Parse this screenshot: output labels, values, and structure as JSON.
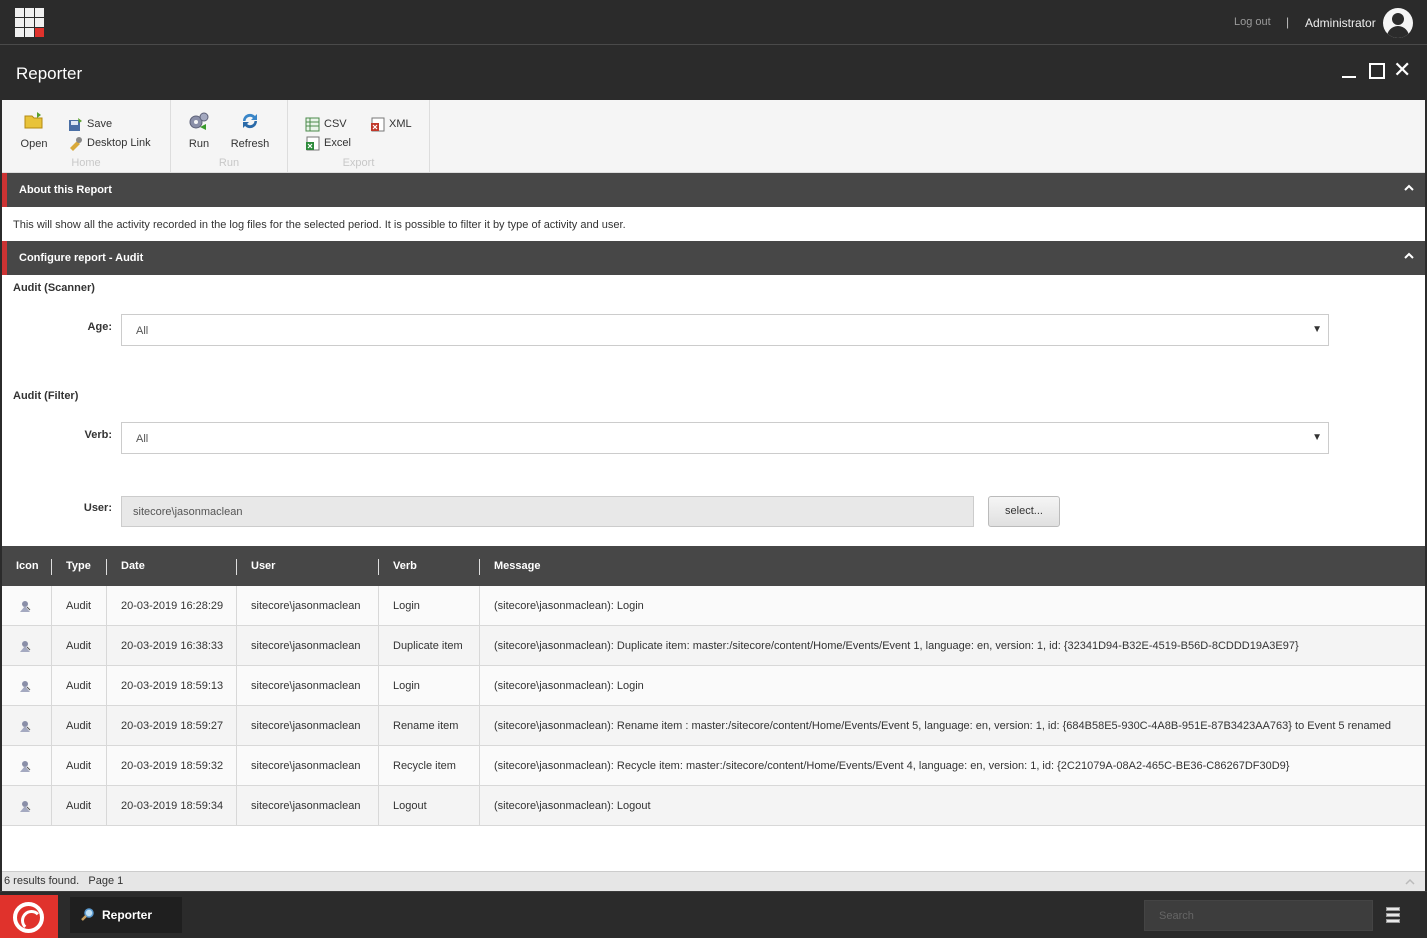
{
  "topbar": {
    "logout_label": "Log out",
    "separator": "|",
    "username": "Administrator"
  },
  "window": {
    "title": "Reporter"
  },
  "ribbon": {
    "home": {
      "label": "Home",
      "open_label": "Open",
      "save_label": "Save",
      "desktop_link_label": "Desktop Link"
    },
    "run": {
      "label": "Run",
      "run_label": "Run",
      "refresh_label": "Refresh"
    },
    "export": {
      "label": "Export",
      "csv_label": "CSV",
      "excel_label": "Excel",
      "xml_label": "XML"
    }
  },
  "about": {
    "header": "About this Report",
    "text": "This will show all the activity recorded in the log files for the selected period. It is possible to filter it by type of activity and user."
  },
  "configure": {
    "header": "Configure report - Audit",
    "scanner_label": "Audit (Scanner)",
    "age_label": "Age:",
    "age_value": "All",
    "filter_label": "Audit (Filter)",
    "verb_label": "Verb:",
    "verb_value": "All",
    "user_label": "User:",
    "user_value": "sitecore\\jasonmaclean",
    "select_button": "select..."
  },
  "table": {
    "columns": [
      "Icon",
      "Type",
      "Date",
      "User",
      "Verb",
      "Message"
    ],
    "rows": [
      {
        "type": "Audit",
        "date": "20-03-2019 16:28:29",
        "user": "sitecore\\jasonmaclean",
        "verb": "Login",
        "message": "(sitecore\\jasonmaclean): Login"
      },
      {
        "type": "Audit",
        "date": "20-03-2019 16:38:33",
        "user": "sitecore\\jasonmaclean",
        "verb": "Duplicate item",
        "message": "(sitecore\\jasonmaclean): Duplicate item: master:/sitecore/content/Home/Events/Event 1, language: en, version: 1, id: {32341D94-B32E-4519-B56D-8CDDD19A3E97}"
      },
      {
        "type": "Audit",
        "date": "20-03-2019 18:59:13",
        "user": "sitecore\\jasonmaclean",
        "verb": "Login",
        "message": "(sitecore\\jasonmaclean): Login"
      },
      {
        "type": "Audit",
        "date": "20-03-2019 18:59:27",
        "user": "sitecore\\jasonmaclean",
        "verb": "Rename item",
        "message": "(sitecore\\jasonmaclean): Rename item : master:/sitecore/content/Home/Events/Event 5, language: en, version: 1, id: {684B58E5-930C-4A8B-951E-87B3423AA763} to Event 5 renamed"
      },
      {
        "type": "Audit",
        "date": "20-03-2019 18:59:32",
        "user": "sitecore\\jasonmaclean",
        "verb": "Recycle item",
        "message": "(sitecore\\jasonmaclean): Recycle item: master:/sitecore/content/Home/Events/Event 4, language: en, version: 1, id: {2C21079A-08A2-465C-BE36-C86267DF30D9}"
      },
      {
        "type": "Audit",
        "date": "20-03-2019 18:59:34",
        "user": "sitecore\\jasonmaclean",
        "verb": "Logout",
        "message": "(sitecore\\jasonmaclean): Logout"
      }
    ]
  },
  "footer": {
    "status": "6 results found.   Page 1"
  },
  "taskbar": {
    "app_label": "Reporter",
    "search_placeholder": "Search"
  },
  "colors": {
    "accent": "#e0322c",
    "dark": "#2b2b2b",
    "section_header": "#474747"
  }
}
